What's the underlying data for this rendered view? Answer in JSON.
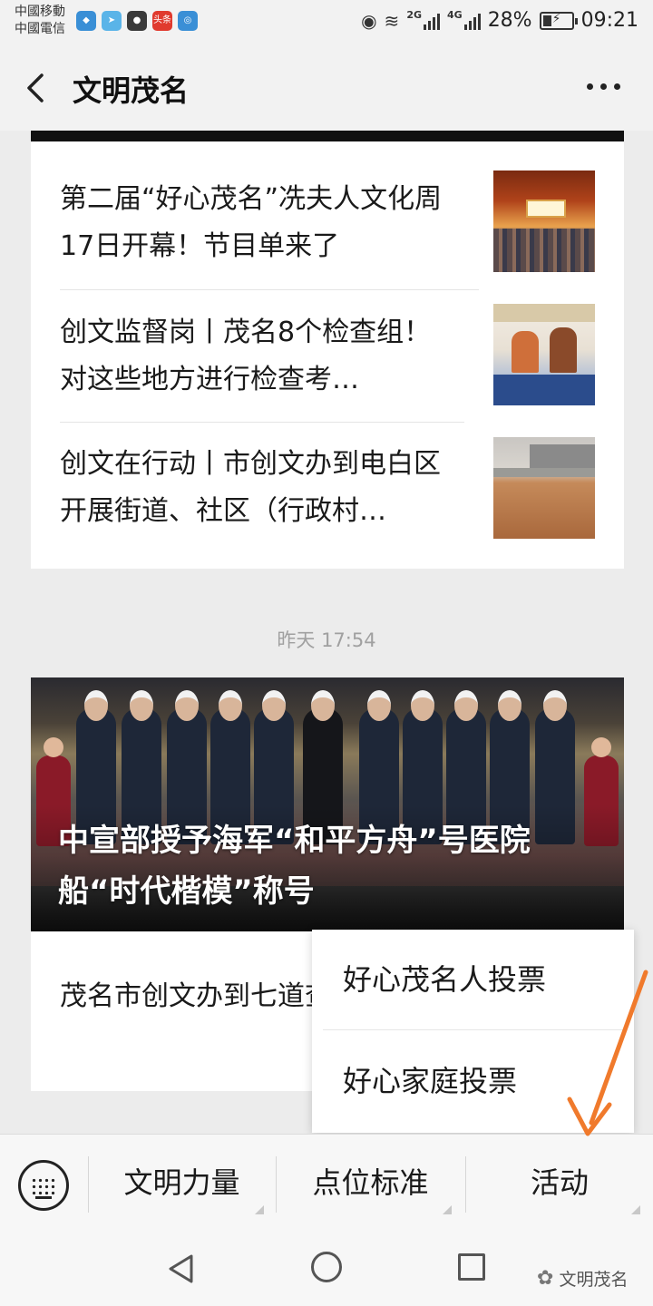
{
  "status_bar": {
    "carrier_1": "中國移動",
    "carrier_2": "中國電信",
    "notification_icons": [
      "shield-icon",
      "paper-plane-icon",
      "wechat-icon",
      "toutiao-icon",
      "app-icon"
    ],
    "notification_label": "头条",
    "net_2g": "2G",
    "net_4g": "4G",
    "battery": "28%",
    "time": "09:21"
  },
  "titlebar": {
    "title": "文明茂名"
  },
  "card1": {
    "articles": [
      {
        "title": "第二届“好心茂名”冼夫人文化周17日开幕！节目单来了"
      },
      {
        "title": "创文监督岗丨茂名8个检查组！对这些地方进行检查考…"
      },
      {
        "title": "创文在行动丨市创文办到电白区开展街道、社区（行政村…"
      }
    ]
  },
  "timestamp": "昨天 17:54",
  "card2": {
    "hero_caption": "中宣部授予海军“和平方舟”号医院船“时代楷模”称号",
    "sub_title": "茂名市创文办到七道查考评"
  },
  "popup": {
    "items": [
      "好心茂名人投票",
      "好心家庭投票"
    ]
  },
  "bottom_menu": {
    "items": [
      "文明力量",
      "点位标准",
      "活动"
    ]
  },
  "watermark": "文明茂名",
  "colors": {
    "arrow": "#f07a2c",
    "background": "#ececec"
  }
}
